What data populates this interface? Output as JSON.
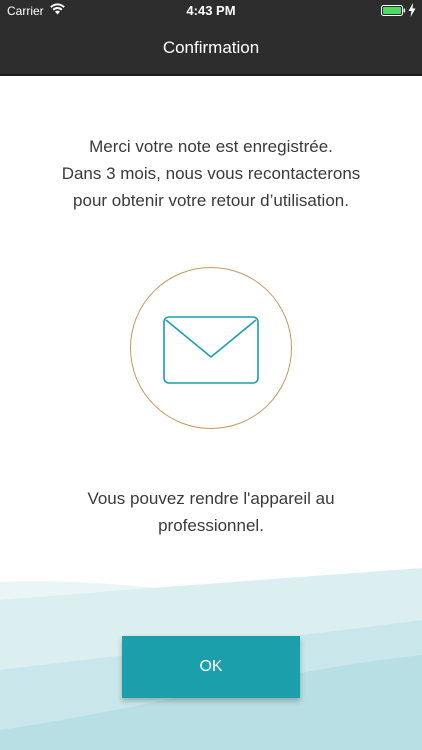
{
  "status_bar": {
    "carrier": "Carrier",
    "time": "4:43 PM",
    "wifi_icon": "wifi-icon",
    "battery_icon": "battery-full-icon",
    "charging_icon": "charging-bolt-icon",
    "battery_color": "#4cd964"
  },
  "nav": {
    "title": "Confirmation",
    "background": "#2d2d2d"
  },
  "confirmation": {
    "line1": "Merci votre note est enregistrée.",
    "line2": "Dans 3 mois, nous vous recontacterons",
    "line3": "pour obtenir votre retour d’utilisation."
  },
  "illustration": {
    "icon": "envelope-icon",
    "circle_color": "#c7975a",
    "envelope_color": "#1a9fab"
  },
  "instruction": {
    "line1": "Vous pouvez rendre l'appareil au",
    "line2": "professionnel."
  },
  "actions": {
    "ok_label": "OK",
    "ok_color": "#1a9fab"
  }
}
